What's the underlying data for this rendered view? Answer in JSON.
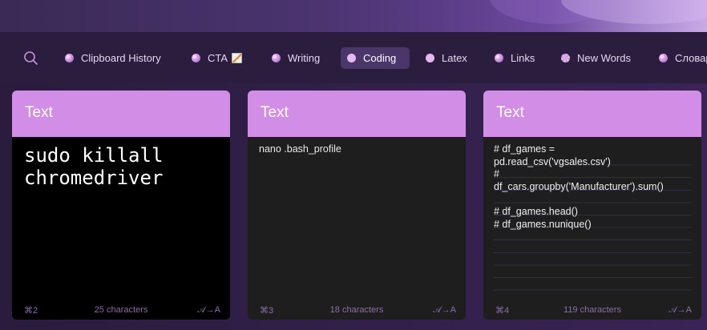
{
  "toolbar": {
    "search_icon": "search-icon",
    "tabs": [
      {
        "label": "Clipboard History",
        "emoji": ""
      },
      {
        "label": "CTA",
        "emoji": "memo"
      },
      {
        "label": "Writing",
        "emoji": ""
      },
      {
        "label": "Coding",
        "emoji": ""
      },
      {
        "label": "Latex",
        "emoji": ""
      },
      {
        "label": "Links",
        "emoji": ""
      },
      {
        "label": "New Words",
        "emoji": ""
      },
      {
        "label": "Словар",
        "emoji": ""
      }
    ],
    "active_tab": "Coding"
  },
  "cards": [
    {
      "type_label": "Text",
      "content": "sudo killall\nchromedriver",
      "shortcut": "⌘2",
      "char_count": "25 characters",
      "format_icon": "𝒜→A"
    },
    {
      "type_label": "Text",
      "content": "nano .bash_profile",
      "shortcut": "⌘3",
      "char_count": "18 characters",
      "format_icon": "𝒜→A"
    },
    {
      "type_label": "Text",
      "content": "# df_games =\npd.read_csv('vgsales.csv')\n#\ndf_cars.groupby('Manufacturer').sum()\n\n# df_games.head()\n# df_games.nunique()",
      "shortcut": "⌘4",
      "char_count": "119 characters",
      "format_icon": "𝒜→A"
    }
  ],
  "colors": {
    "card_header": "#d28de6",
    "active_tab_bg": "#4a3668",
    "background": "#2b1d3e"
  }
}
